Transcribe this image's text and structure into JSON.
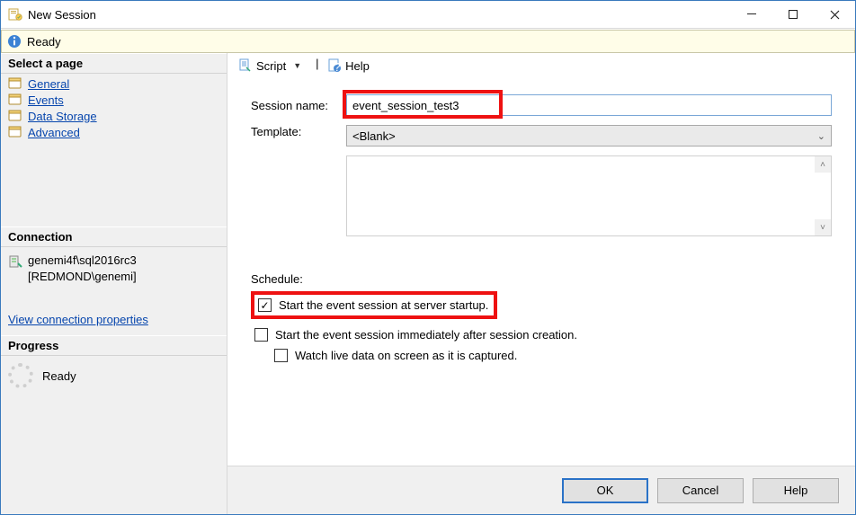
{
  "window": {
    "title": "New Session"
  },
  "status": {
    "text": "Ready"
  },
  "left": {
    "select_page_header": "Select a page",
    "pages": [
      {
        "id": "general",
        "label": "General"
      },
      {
        "id": "events",
        "label": "Events"
      },
      {
        "id": "data-storage",
        "label": "Data Storage"
      },
      {
        "id": "advanced",
        "label": "Advanced"
      }
    ],
    "connection_header": "Connection",
    "connection_line1": "genemi4f\\sql2016rc3",
    "connection_line2": "[REDMOND\\genemi]",
    "view_conn_props": "View connection properties",
    "progress_header": "Progress",
    "progress_text": "Ready"
  },
  "toolbar": {
    "script_label": "Script",
    "help_label": "Help"
  },
  "form": {
    "session_name_label": "Session name:",
    "session_name_value": "event_session_test3",
    "template_label": "Template:",
    "template_value": "<Blank>",
    "schedule_header": "Schedule:",
    "chk_startup": "Start the event session at server startup.",
    "chk_startup_checked": true,
    "chk_immediate": "Start the event session immediately after session creation.",
    "chk_immediate_checked": false,
    "chk_watch": "Watch live data on screen as it is captured.",
    "chk_watch_checked": false
  },
  "footer": {
    "ok": "OK",
    "cancel": "Cancel",
    "help": "Help"
  }
}
